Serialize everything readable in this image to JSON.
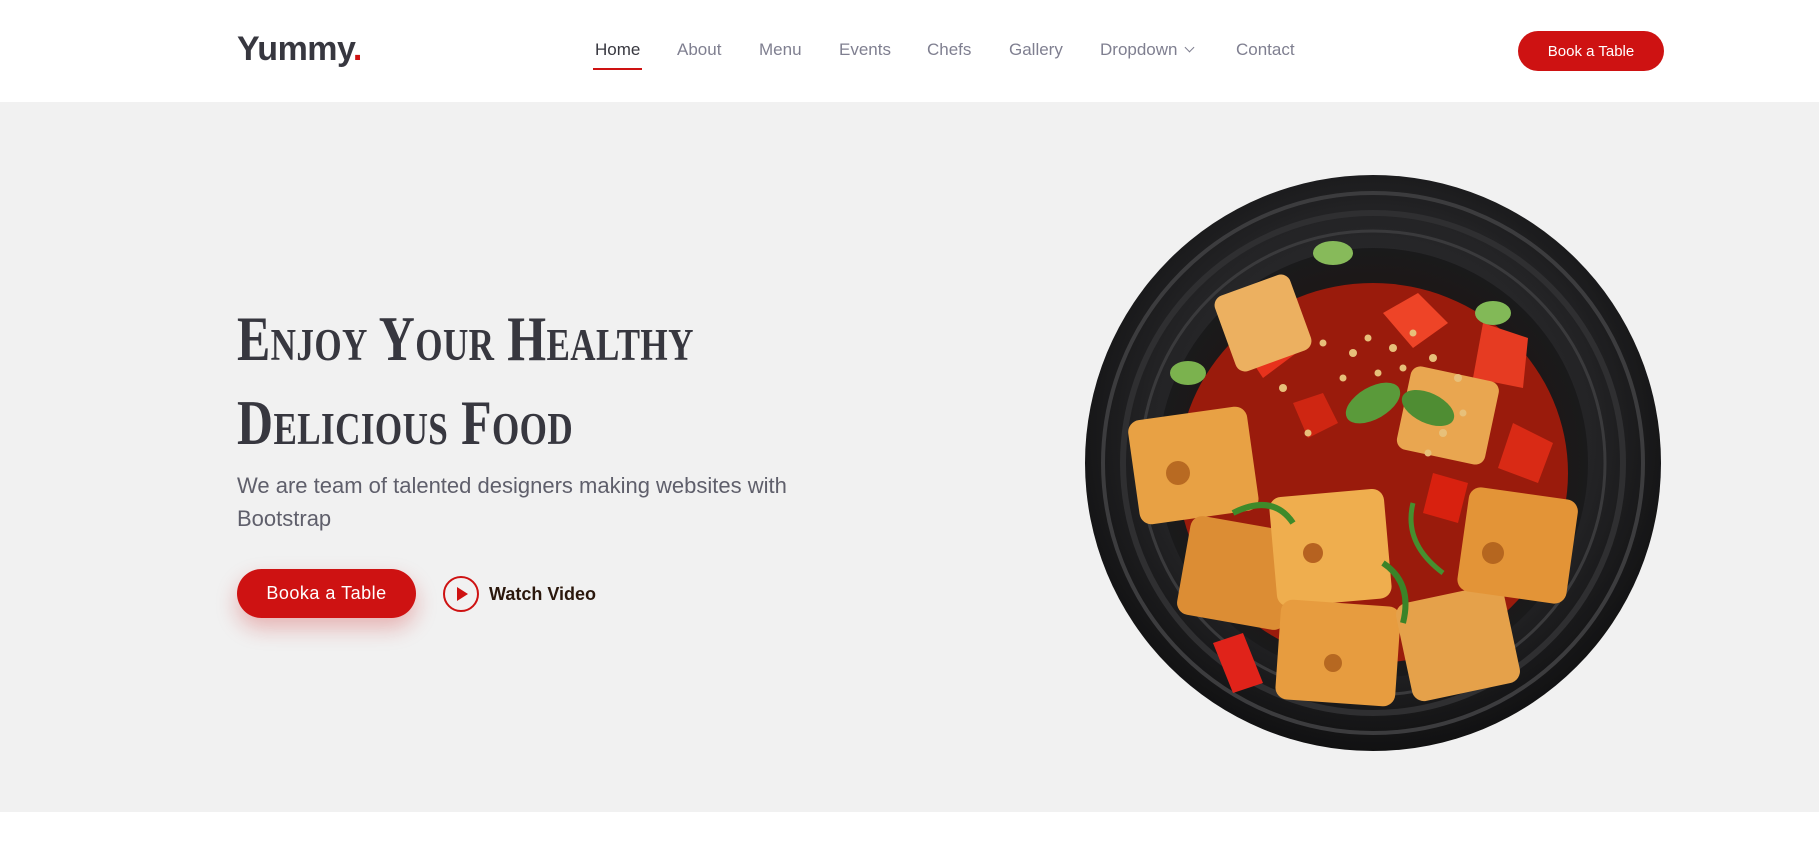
{
  "header": {
    "logo_text": "Yummy",
    "logo_dot": ".",
    "nav": [
      {
        "label": "Home",
        "active": true
      },
      {
        "label": "About"
      },
      {
        "label": "Menu"
      },
      {
        "label": "Events"
      },
      {
        "label": "Chefs"
      },
      {
        "label": "Gallery"
      },
      {
        "label": "Dropdown",
        "has_chevron": true
      },
      {
        "label": "Contact"
      }
    ],
    "cta_label": "Book a Table"
  },
  "hero": {
    "title_line1": "Enjoy Your Healthy",
    "title_line2": "Delicious Food",
    "subtitle": "We are team of talented designers making websites with Bootstrap",
    "primary_button": "Booka a Table",
    "video_button": "Watch Video",
    "image_icon": "food-plate-image"
  },
  "colors": {
    "accent": "#ce1212",
    "text_dark": "#37373f",
    "nav_text": "#7f7f90",
    "hero_bg": "#f1f1f1"
  }
}
